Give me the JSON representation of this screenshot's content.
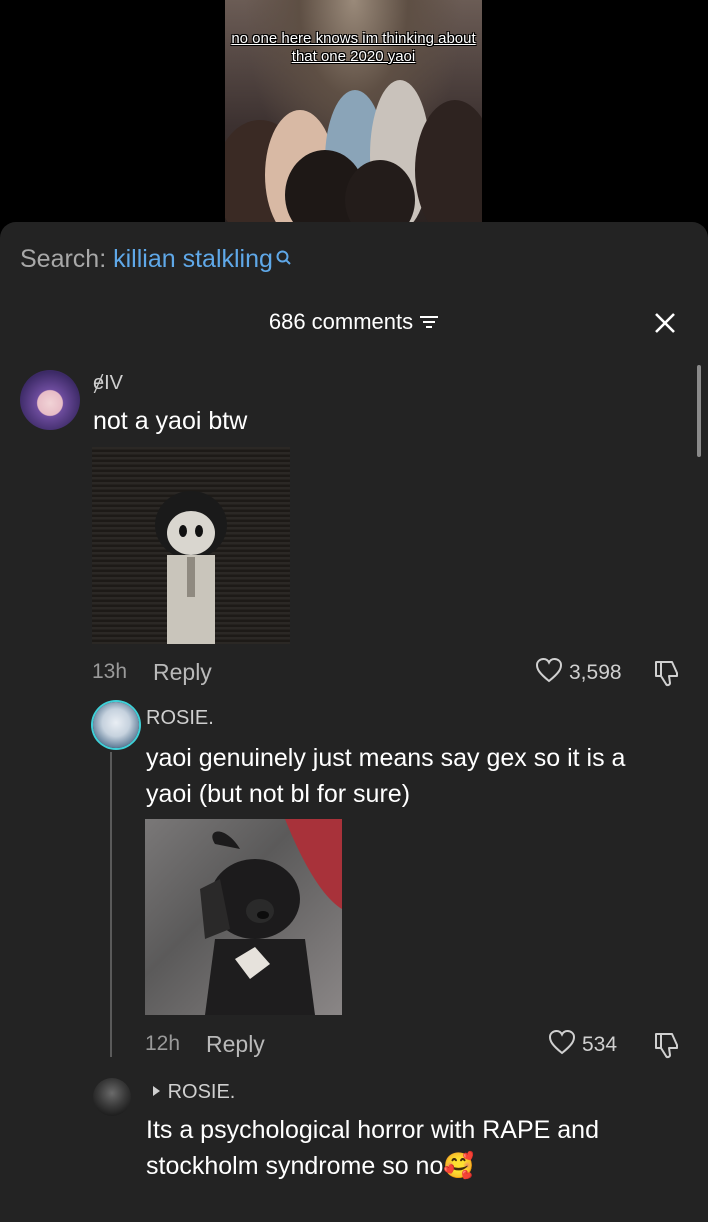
{
  "video": {
    "caption": "no one here knows im thinking about that one 2020 yaoi"
  },
  "search": {
    "prefix": "Search:",
    "term": "killian stalkling"
  },
  "header": {
    "count_label": "686 comments"
  },
  "comments": [
    {
      "username": "ɇIV",
      "text": "not a yaoi btw",
      "time": "13h",
      "reply_label": "Reply",
      "likes": "3,598"
    },
    {
      "username": "ROSIE.",
      "text_line1": "yaoi genuinely just means say gex so it is a",
      "text_line2": "yaoi (but not bl for sure)",
      "time": "12h",
      "reply_label": "Reply",
      "likes": "534"
    },
    {
      "reply_to": "ROSIE.",
      "text_line1": "Its a psychological horror with RAPE and",
      "text_line2": "stockholm syndrome so no",
      "emoji": "🥰"
    }
  ],
  "colors": {
    "sheet": "#232323",
    "search_term": "#5fa8e8",
    "avatar_ring": "#3fd0d8"
  }
}
